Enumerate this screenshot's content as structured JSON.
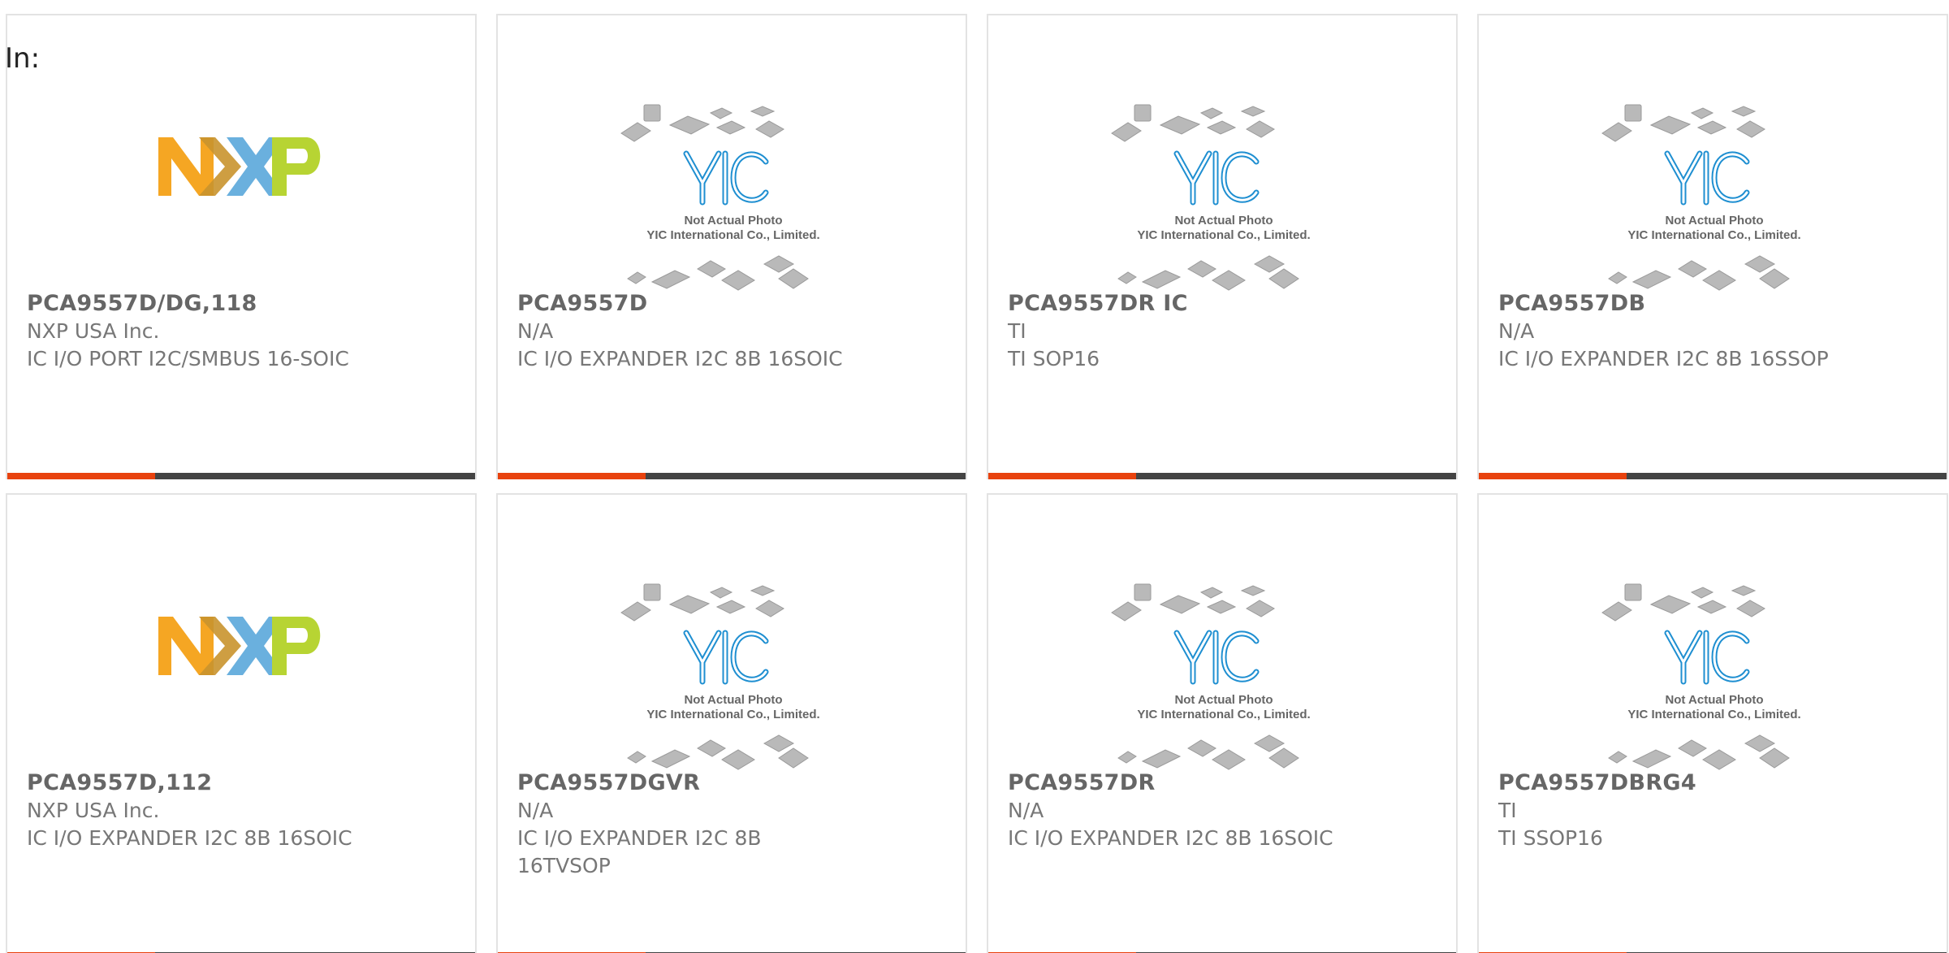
{
  "page": {
    "label": "In:"
  },
  "colors": {
    "accent_bar": "#e8420e",
    "bar_dark": "#444444",
    "nxp_orange": "#f5a623",
    "nxp_blue": "#6ab0de",
    "nxp_green": "#b7d433",
    "yic_blue": "#1f8fd1"
  },
  "placeholder": {
    "line1": "Not Actual Photo",
    "line2": "YIC International Co., Limited."
  },
  "products": [
    {
      "part": "PCA9557D/DG,118",
      "manufacturer": "NXP USA Inc.",
      "description": "IC I/O PORT I2C/SMBUS 16-SOIC",
      "image": "nxp-logo"
    },
    {
      "part": "PCA9557D",
      "manufacturer": "N/A",
      "description": "IC I/O EXPANDER I2C 8B 16SOIC",
      "image": "yic-placeholder"
    },
    {
      "part": "PCA9557DR IC",
      "manufacturer": "TI",
      "description": "TI SOP16",
      "image": "yic-placeholder"
    },
    {
      "part": "PCA9557DB",
      "manufacturer": "N/A",
      "description": "IC I/O EXPANDER I2C 8B 16SSOP",
      "image": "yic-placeholder"
    },
    {
      "part": "PCA9557D,112",
      "manufacturer": "NXP USA Inc.",
      "description": "IC I/O EXPANDER I2C 8B 16SOIC",
      "image": "nxp-logo"
    },
    {
      "part": "PCA9557DGVR",
      "manufacturer": "N/A",
      "description": "IC I/O EXPANDER I2C 8B 16TVSOP",
      "image": "yic-placeholder"
    },
    {
      "part": "PCA9557DR",
      "manufacturer": "N/A",
      "description": "IC I/O EXPANDER I2C 8B 16SOIC",
      "image": "yic-placeholder"
    },
    {
      "part": "PCA9557DBRG4",
      "manufacturer": "TI",
      "description": "TI SSOP16",
      "image": "yic-placeholder"
    }
  ]
}
